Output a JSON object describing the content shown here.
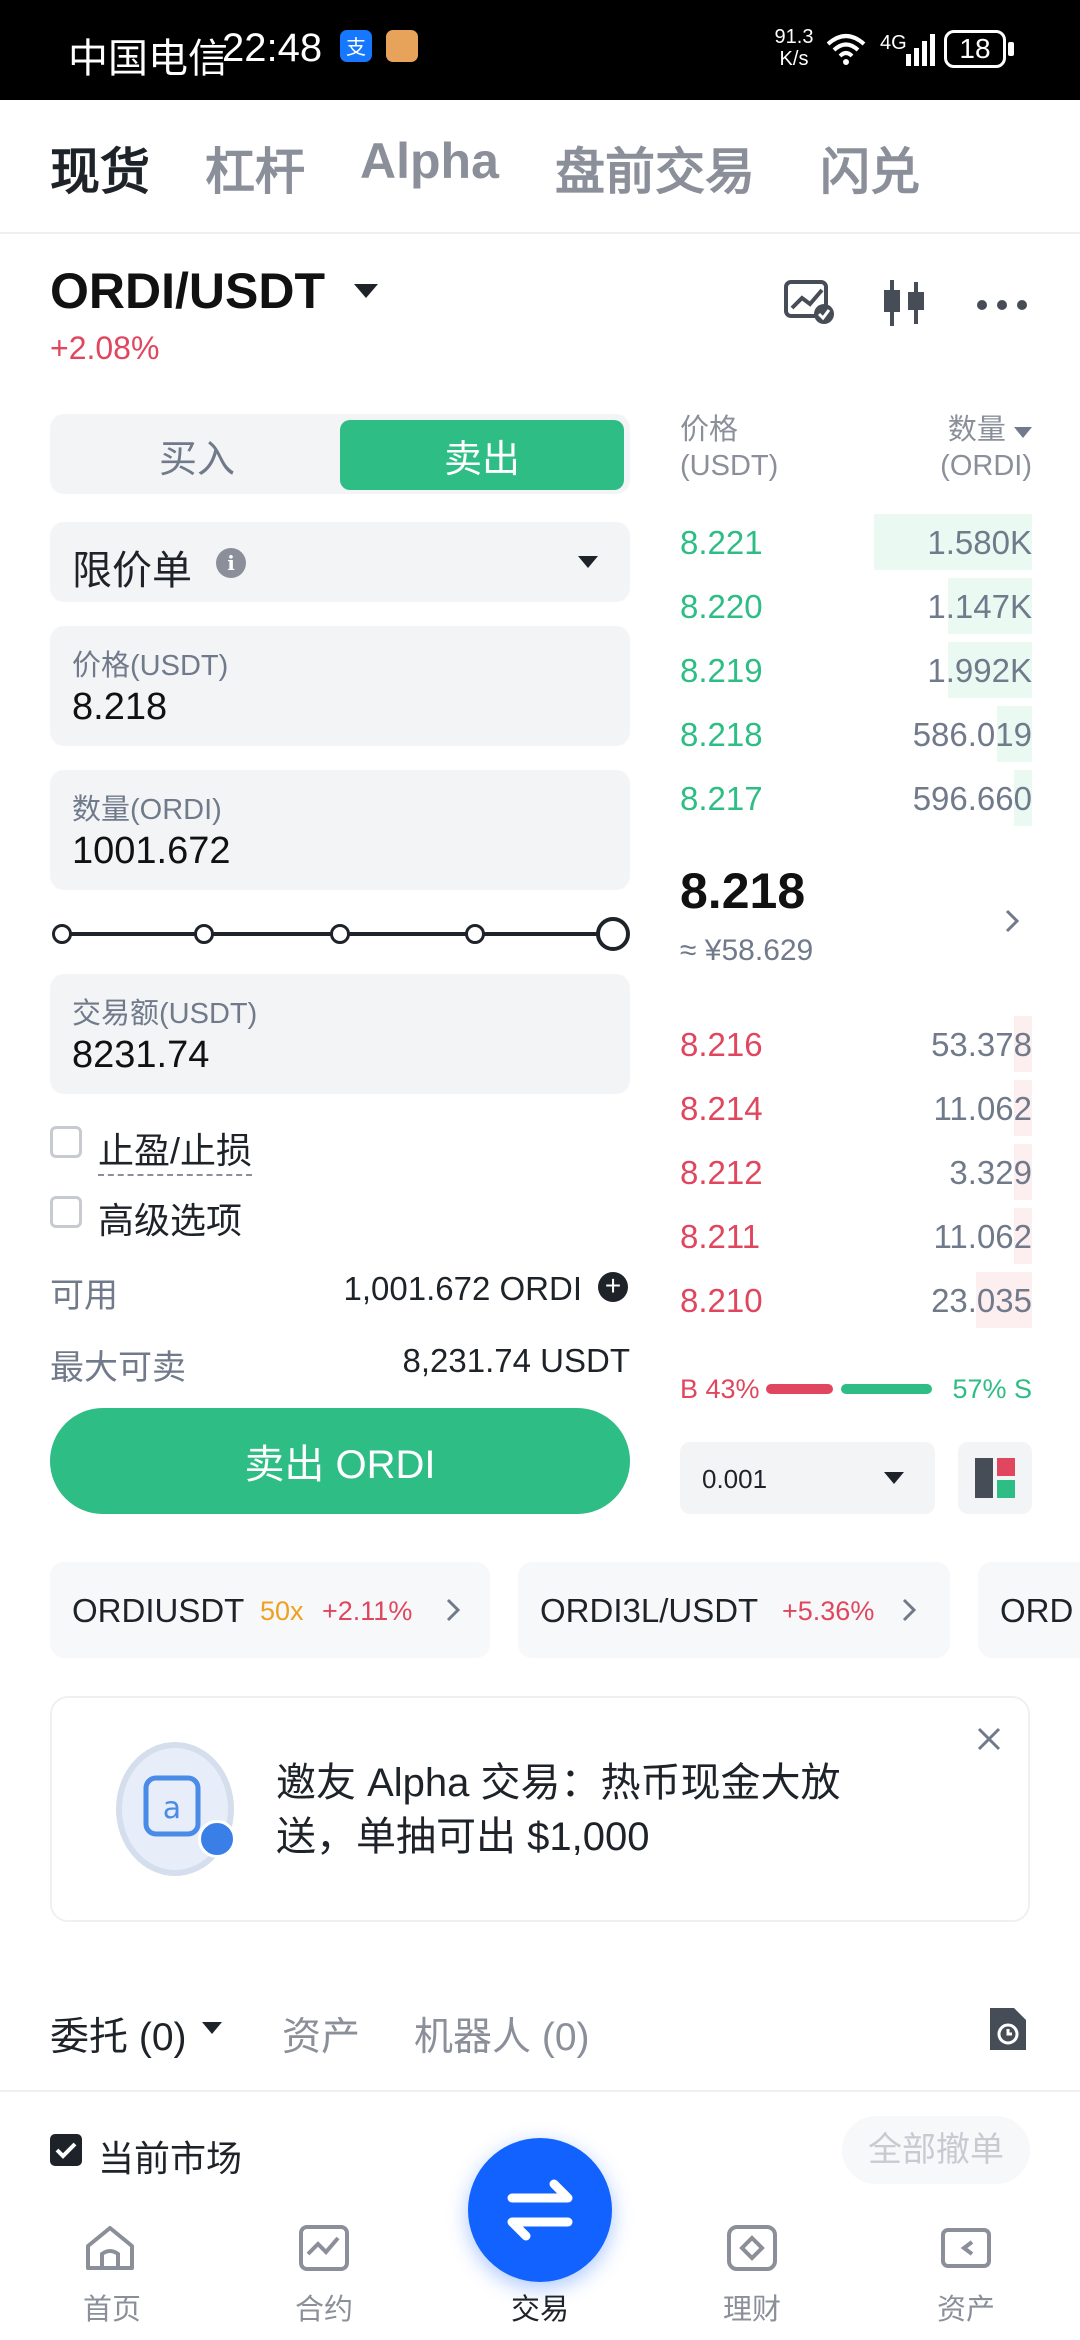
{
  "status_bar": {
    "carrier": "中国电信",
    "time": "22:48",
    "net_speed_value": "91.3",
    "net_speed_unit": "K/s",
    "network": "4G",
    "battery": "18"
  },
  "top_tabs": [
    {
      "label": "现货",
      "active": true
    },
    {
      "label": "杠杆",
      "active": false
    },
    {
      "label": "Alpha",
      "active": false
    },
    {
      "label": "盘前交易",
      "active": false
    },
    {
      "label": "闪兑",
      "active": false
    }
  ],
  "pair": {
    "symbol": "ORDI/USDT",
    "change": "+2.08%"
  },
  "trade_form": {
    "side_buy": "买入",
    "side_sell": "卖出",
    "order_type": "限价单",
    "price_label": "价格(USDT)",
    "price_value": "8.218",
    "qty_label": "数量(ORDI)",
    "qty_value": "1001.672",
    "slider_percent": 100,
    "total_label": "交易额(USDT)",
    "total_value": "8231.74",
    "tp_sl_label": "止盈/止损",
    "advanced_label": "高级选项",
    "available_label": "可用",
    "available_value": "1,001.672 ORDI",
    "max_sell_label": "最大可卖",
    "max_sell_value": "8,231.74 USDT",
    "submit_label": "卖出 ORDI"
  },
  "order_book": {
    "price_header": "价格",
    "price_unit": "(USDT)",
    "qty_header": "数量",
    "qty_unit": "(ORDI)",
    "asks": [
      {
        "price": "8.221",
        "qty": "1.580K",
        "depth": 0.45
      },
      {
        "price": "8.220",
        "qty": "1.147K",
        "depth": 0.24
      },
      {
        "price": "8.219",
        "qty": "1.992K",
        "depth": 0.24
      },
      {
        "price": "8.218",
        "qty": "586.019",
        "depth": 0.1
      },
      {
        "price": "8.217",
        "qty": "596.660",
        "depth": 0.05
      }
    ],
    "mid_price": "8.218",
    "mid_cny": "≈ ¥58.629",
    "bids": [
      {
        "price": "8.216",
        "qty": "53.378",
        "depth": 0.05
      },
      {
        "price": "8.214",
        "qty": "11.062",
        "depth": 0.05
      },
      {
        "price": "8.212",
        "qty": "3.329",
        "depth": 0.05
      },
      {
        "price": "8.211",
        "qty": "11.062",
        "depth": 0.05
      },
      {
        "price": "8.210",
        "qty": "23.035",
        "depth": 0.16
      }
    ],
    "buy_ratio": "B 43%",
    "sell_ratio": "57% S",
    "buy_ratio_value": 43,
    "precision": "0.001"
  },
  "related_pairs": [
    {
      "symbol": "ORDIUSDT",
      "leverage": "50x",
      "change": "+2.11%"
    },
    {
      "symbol": "ORDI3L/USDT",
      "leverage": "",
      "change": "+5.36%"
    },
    {
      "symbol": "ORD",
      "leverage": "",
      "change": ""
    }
  ],
  "promo": {
    "text": "邀友 Alpha 交易：热币现金大放送，单抽可出 $1,000"
  },
  "bottom_tabs": {
    "orders": "委托 (0)",
    "assets": "资产",
    "bots": "机器人 (0)"
  },
  "filters": {
    "current_market": "当前市场",
    "cancel_all": "全部撤单"
  },
  "bottom_nav": [
    {
      "label": "首页",
      "icon": "home-icon"
    },
    {
      "label": "合约",
      "icon": "futures-chart-icon"
    },
    {
      "label": "交易",
      "icon": "swap-arrows-icon"
    },
    {
      "label": "理财",
      "icon": "earn-icon"
    },
    {
      "label": "资产",
      "icon": "wallet-icon"
    }
  ],
  "colors": {
    "buy_green": "#2ebd85",
    "sell_red": "#e0475e",
    "nav_blue": "#1262ff"
  }
}
